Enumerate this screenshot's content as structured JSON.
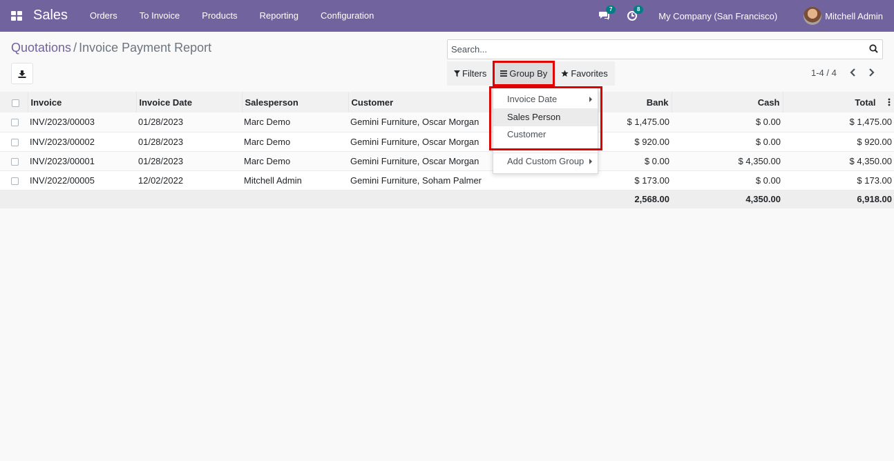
{
  "navbar": {
    "app_name": "Sales",
    "menu": [
      "Orders",
      "To Invoice",
      "Products",
      "Reporting",
      "Configuration"
    ],
    "messages_count": "7",
    "activities_count": "8",
    "company": "My Company (San Francisco)",
    "user": "Mitchell Admin"
  },
  "breadcrumb": {
    "parent": "Quotations",
    "separator": "/",
    "current": "Invoice Payment Report"
  },
  "search": {
    "placeholder": "Search...",
    "value": ""
  },
  "search_buttons": {
    "filters": "Filters",
    "group_by": "Group By",
    "favorites": "Favorites"
  },
  "pager": {
    "value": "1-4 / 4"
  },
  "table": {
    "columns": [
      "Invoice",
      "Invoice Date",
      "Salesperson",
      "Customer",
      "Bank",
      "Cash",
      "Total"
    ],
    "rows": [
      {
        "invoice": "INV/2023/00003",
        "date": "01/28/2023",
        "salesperson": "Marc Demo",
        "customer": "Gemini Furniture, Oscar Morgan",
        "bank": "$ 1,475.00",
        "cash": "$ 0.00",
        "total": "$ 1,475.00"
      },
      {
        "invoice": "INV/2023/00002",
        "date": "01/28/2023",
        "salesperson": "Marc Demo",
        "customer": "Gemini Furniture, Oscar Morgan",
        "bank": "$ 920.00",
        "cash": "$ 0.00",
        "total": "$ 920.00"
      },
      {
        "invoice": "INV/2023/00001",
        "date": "01/28/2023",
        "salesperson": "Marc Demo",
        "customer": "Gemini Furniture, Oscar Morgan",
        "bank": "$ 0.00",
        "cash": "$ 4,350.00",
        "total": "$ 4,350.00"
      },
      {
        "invoice": "INV/2022/00005",
        "date": "12/02/2022",
        "salesperson": "Mitchell Admin",
        "customer": "Gemini Furniture, Soham Palmer",
        "bank": "$ 173.00",
        "cash": "$ 0.00",
        "total": "$ 173.00"
      }
    ],
    "totals": {
      "bank": "2,568.00",
      "cash": "4,350.00",
      "total": "6,918.00"
    }
  },
  "group_by_menu": {
    "items": [
      "Invoice Date",
      "Sales Person",
      "Customer"
    ],
    "custom": "Add Custom Group"
  },
  "colors": {
    "navbar": "#71639e",
    "highlight": "#e10000",
    "badge": "#017e84"
  }
}
